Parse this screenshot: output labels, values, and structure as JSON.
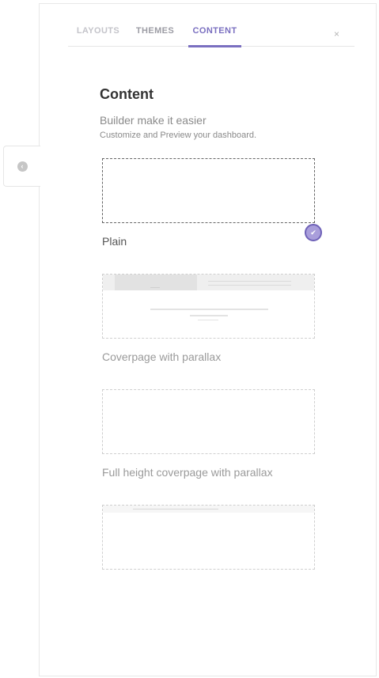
{
  "tabs": {
    "layouts": "LAYOUTS",
    "themes": "THEMES",
    "content": "CONTENT",
    "active": "CONTENT"
  },
  "close_label": "×",
  "handle_icon": "collapse-arrow-icon",
  "header": {
    "title": "Content",
    "subtitle": "Builder make it easier",
    "description": "Customize and Preview your dashboard."
  },
  "options": [
    {
      "label": "Plain",
      "selected": true
    },
    {
      "label": "Coverpage with parallax",
      "selected": false
    },
    {
      "label": "Full height coverpage with parallax",
      "selected": false
    },
    {
      "label": "",
      "selected": false
    }
  ],
  "colors": {
    "accent": "#7a6fc0",
    "check_fill": "#a99edb",
    "muted_text": "#9a9a9a"
  }
}
